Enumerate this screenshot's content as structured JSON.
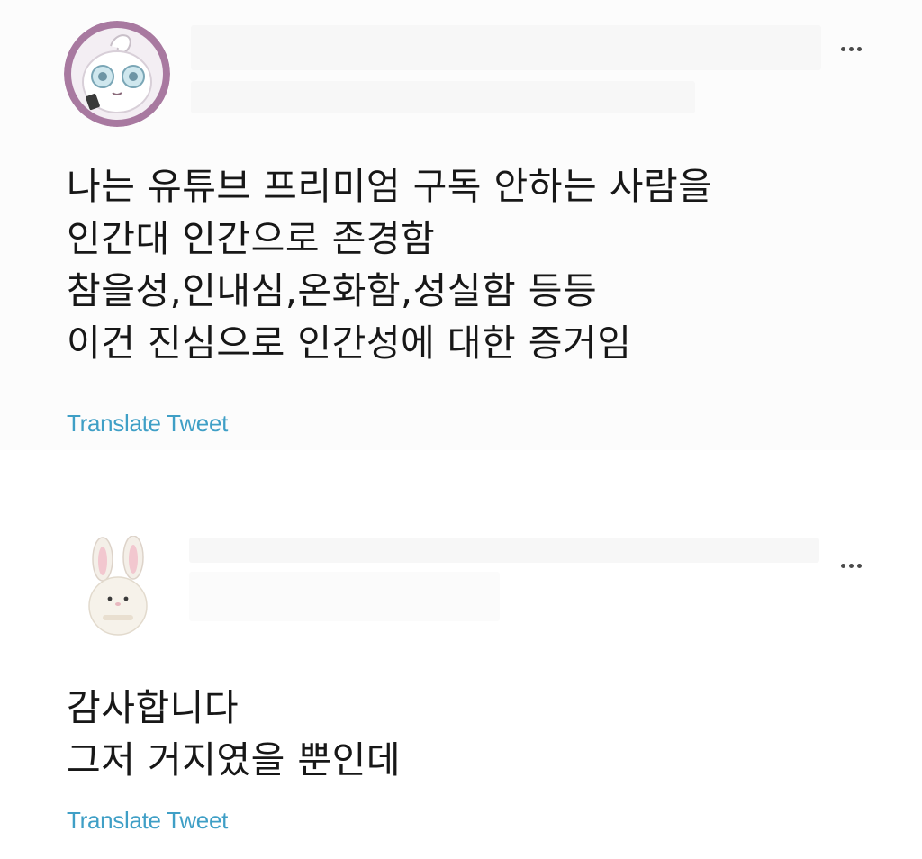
{
  "tweets": [
    {
      "avatar": "jigglypuff-avatar",
      "lines": [
        "나는 유튜브 프리미엄 구독 안하는 사람을",
        "인간대 인간으로 존경함",
        "참을성,인내심,온화함,성실함 등등",
        "이건 진심으로 인간성에 대한 증거임"
      ],
      "translate_label": "Translate Tweet"
    },
    {
      "avatar": "bunny-plush-avatar",
      "lines": [
        "감사합니다",
        "그저 거지였을 뿐인데"
      ],
      "translate_label": "Translate Tweet"
    }
  ],
  "colors": {
    "link": "#3f9fc6",
    "avatar1_ring": "#a879a0",
    "text": "#171717"
  },
  "icons": [
    "more-options-icon"
  ]
}
